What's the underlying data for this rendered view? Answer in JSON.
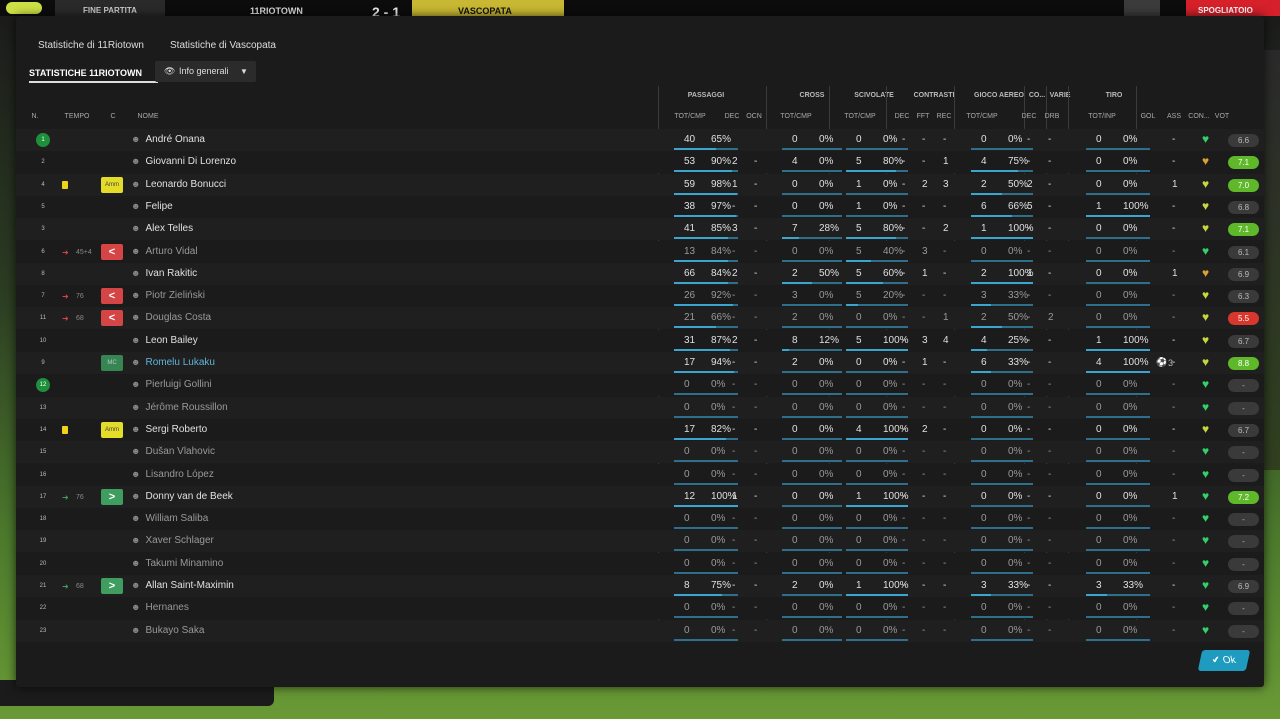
{
  "topbar": {
    "end_label": "FINE PARTITA",
    "home_team": "11RIOTOWN",
    "score": "2 - 1",
    "away_team": "VASCOPATA",
    "right_label": "SPOGLIATOIO"
  },
  "tabs": [
    {
      "label": "Statistiche di 11Riotown"
    },
    {
      "label": "Statistiche di Vascopata"
    }
  ],
  "section_title": "STATISTICHE 11RIOTOWN",
  "view_dropdown": {
    "label": "Info generali",
    "icon": "eye-icon"
  },
  "groups": {
    "passaggi": "PASSAGGI",
    "cross": "CROSS",
    "scivolate": "SCIVOLATE",
    "contrasti": "CONTRASTI",
    "gioco_aereo": "GIOCO AEREO",
    "co": "CO...",
    "varie": "VARIE",
    "tiro": "TIRO"
  },
  "columns": {
    "n": "N.",
    "tempo": "TEMPO",
    "c": "C",
    "nome": "NOME",
    "tot_cmp": "TOT/CMP",
    "dec": "DEC",
    "ocn": "OCN",
    "fft": "FFT",
    "rec": "REC",
    "drb": "DRB",
    "tot_inp": "TOT/INP",
    "gol": "GOL",
    "ass": "ASS",
    "con": "CON...",
    "vot": "VOT"
  },
  "players": [
    {
      "n": "1",
      "gk": true,
      "tempo": "",
      "sub": "",
      "tag": "",
      "name": "André Onana",
      "dim": false,
      "pass": [
        "40",
        "65%"
      ],
      "pdec": "",
      "pocn": "",
      "cross": [
        "0",
        "0%"
      ],
      "sciv": [
        "0",
        "0%"
      ],
      "cdec": "-",
      "cfft": "-",
      "crec": "-",
      "aereo": [
        "0",
        "0%"
      ],
      "codec": "-",
      "drb": "-",
      "tiro": [
        "0",
        "0%"
      ],
      "gol": "",
      "ass": "-",
      "heart": "green",
      "vot": "6.6",
      "vclass": "grey"
    },
    {
      "n": "2",
      "tempo": "",
      "sub": "",
      "tag": "",
      "name": "Giovanni Di Lorenzo",
      "dim": false,
      "pass": [
        "53",
        "90%"
      ],
      "pdec": "2",
      "pocn": "-",
      "cross": [
        "4",
        "0%"
      ],
      "sciv": [
        "5",
        "80%"
      ],
      "cdec": "-",
      "cfft": "-",
      "crec": "1",
      "aereo": [
        "4",
        "75%"
      ],
      "codec": "-",
      "drb": "-",
      "tiro": [
        "0",
        "0%"
      ],
      "gol": "",
      "ass": "-",
      "heart": "orange",
      "vot": "7.1",
      "vclass": "green"
    },
    {
      "n": "4",
      "tempo": "",
      "card": true,
      "sub": "",
      "tag": "Amm",
      "name": "Leonardo Bonucci",
      "dim": false,
      "pass": [
        "59",
        "98%"
      ],
      "pdec": "1",
      "pocn": "-",
      "cross": [
        "0",
        "0%"
      ],
      "sciv": [
        "1",
        "0%"
      ],
      "cdec": "-",
      "cfft": "2",
      "crec": "3",
      "aereo": [
        "2",
        "50%"
      ],
      "codec": "2",
      "drb": "-",
      "tiro": [
        "0",
        "0%"
      ],
      "gol": "",
      "ass": "1",
      "heart": "yellow",
      "vot": "7.0",
      "vclass": "green"
    },
    {
      "n": "5",
      "tempo": "",
      "sub": "",
      "tag": "",
      "name": "Felipe",
      "dim": false,
      "pass": [
        "38",
        "97%"
      ],
      "pdec": "-",
      "pocn": "-",
      "cross": [
        "0",
        "0%"
      ],
      "sciv": [
        "1",
        "0%"
      ],
      "cdec": "-",
      "cfft": "-",
      "crec": "-",
      "aereo": [
        "6",
        "66%"
      ],
      "codec": "5",
      "drb": "-",
      "tiro": [
        "1",
        "100%"
      ],
      "gol": "",
      "ass": "-",
      "heart": "yellow",
      "vot": "6.8",
      "vclass": "grey"
    },
    {
      "n": "3",
      "tempo": "",
      "sub": "",
      "tag": "",
      "name": "Alex Telles",
      "dim": false,
      "pass": [
        "41",
        "85%"
      ],
      "pdec": "3",
      "pocn": "-",
      "cross": [
        "7",
        "28%"
      ],
      "sciv": [
        "5",
        "80%"
      ],
      "cdec": "-",
      "cfft": "-",
      "crec": "2",
      "aereo": [
        "1",
        "100%"
      ],
      "codec": "-",
      "drb": "-",
      "tiro": [
        "0",
        "0%"
      ],
      "gol": "",
      "ass": "-",
      "heart": "yellow",
      "vot": "7.1",
      "vclass": "green"
    },
    {
      "n": "6",
      "tempo": "45+4",
      "subout": true,
      "tag": "<",
      "name": "Arturo Vidal",
      "dim": true,
      "pass": [
        "13",
        "84%"
      ],
      "pdec": "-",
      "pocn": "-",
      "cross": [
        "0",
        "0%"
      ],
      "sciv": [
        "5",
        "40%"
      ],
      "cdec": "-",
      "cfft": "3",
      "crec": "-",
      "aereo": [
        "0",
        "0%"
      ],
      "codec": "-",
      "drb": "-",
      "tiro": [
        "0",
        "0%"
      ],
      "gol": "",
      "ass": "-",
      "heart": "green",
      "vot": "6.1",
      "vclass": "grey"
    },
    {
      "n": "8",
      "tempo": "",
      "sub": "",
      "tag": "",
      "name": "Ivan Rakitic",
      "dim": false,
      "pass": [
        "66",
        "84%"
      ],
      "pdec": "2",
      "pocn": "-",
      "cross": [
        "2",
        "50%"
      ],
      "sciv": [
        "5",
        "60%"
      ],
      "cdec": "-",
      "cfft": "1",
      "crec": "-",
      "aereo": [
        "2",
        "100%"
      ],
      "codec": "1",
      "drb": "-",
      "tiro": [
        "0",
        "0%"
      ],
      "gol": "",
      "ass": "1",
      "heart": "orange",
      "vot": "6.9",
      "vclass": "grey"
    },
    {
      "n": "7",
      "tempo": "76",
      "subout": true,
      "tag": "<",
      "name": "Piotr Zieliński",
      "dim": true,
      "pass": [
        "26",
        "92%"
      ],
      "pdec": "-",
      "pocn": "-",
      "cross": [
        "3",
        "0%"
      ],
      "sciv": [
        "5",
        "20%"
      ],
      "cdec": "-",
      "cfft": "-",
      "crec": "-",
      "aereo": [
        "3",
        "33%"
      ],
      "codec": "-",
      "drb": "-",
      "tiro": [
        "0",
        "0%"
      ],
      "gol": "",
      "ass": "-",
      "heart": "yellow",
      "vot": "6.3",
      "vclass": "grey"
    },
    {
      "n": "11",
      "tempo": "68",
      "subout": true,
      "tag": "<",
      "name": "Douglas Costa",
      "dim": true,
      "pass": [
        "21",
        "66%"
      ],
      "pdec": "-",
      "pocn": "-",
      "cross": [
        "2",
        "0%"
      ],
      "sciv": [
        "0",
        "0%"
      ],
      "cdec": "-",
      "cfft": "-",
      "crec": "1",
      "aereo": [
        "2",
        "50%"
      ],
      "codec": "-",
      "drb": "2",
      "tiro": [
        "0",
        "0%"
      ],
      "gol": "",
      "ass": "-",
      "heart": "yellow",
      "vot": "5.5",
      "vclass": "red"
    },
    {
      "n": "10",
      "tempo": "",
      "sub": "",
      "tag": "",
      "name": "Leon Bailey",
      "dim": false,
      "pass": [
        "31",
        "87%"
      ],
      "pdec": "2",
      "pocn": "-",
      "cross": [
        "8",
        "12%"
      ],
      "sciv": [
        "5",
        "100%"
      ],
      "cdec": "-",
      "cfft": "3",
      "crec": "4",
      "aereo": [
        "4",
        "25%"
      ],
      "codec": "-",
      "drb": "-",
      "tiro": [
        "1",
        "100%"
      ],
      "gol": "",
      "ass": "-",
      "heart": "yellow",
      "vot": "6.7",
      "vclass": "grey"
    },
    {
      "n": "9",
      "tempo": "",
      "sub": "",
      "tag": "MC",
      "name": "Romelu Lukaku",
      "dim": false,
      "link": true,
      "pass": [
        "17",
        "94%"
      ],
      "pdec": "-",
      "pocn": "-",
      "cross": [
        "2",
        "0%"
      ],
      "sciv": [
        "0",
        "0%"
      ],
      "cdec": "-",
      "cfft": "1",
      "crec": "-",
      "aereo": [
        "6",
        "33%"
      ],
      "codec": "-",
      "drb": "-",
      "tiro": [
        "4",
        "100%"
      ],
      "gol": "3",
      "ass": "-",
      "heart": "yellow",
      "vot": "8.8",
      "vclass": "green"
    },
    {
      "n": "12",
      "gk": true,
      "tempo": "",
      "sub": "",
      "tag": "",
      "name": "Pierluigi Gollini",
      "dim": true,
      "pass": [
        "0",
        "0%"
      ],
      "pdec": "-",
      "pocn": "-",
      "cross": [
        "0",
        "0%"
      ],
      "sciv": [
        "0",
        "0%"
      ],
      "cdec": "-",
      "cfft": "-",
      "crec": "-",
      "aereo": [
        "0",
        "0%"
      ],
      "codec": "-",
      "drb": "-",
      "tiro": [
        "0",
        "0%"
      ],
      "gol": "",
      "ass": "-",
      "heart": "green",
      "vot": "-",
      "vclass": "grey"
    },
    {
      "n": "13",
      "tempo": "",
      "sub": "",
      "tag": "",
      "name": "Jérôme Roussillon",
      "dim": true,
      "pass": [
        "0",
        "0%"
      ],
      "pdec": "-",
      "pocn": "-",
      "cross": [
        "0",
        "0%"
      ],
      "sciv": [
        "0",
        "0%"
      ],
      "cdec": "-",
      "cfft": "-",
      "crec": "-",
      "aereo": [
        "0",
        "0%"
      ],
      "codec": "-",
      "drb": "-",
      "tiro": [
        "0",
        "0%"
      ],
      "gol": "",
      "ass": "-",
      "heart": "green",
      "vot": "-",
      "vclass": "grey"
    },
    {
      "n": "14",
      "tempo": "",
      "card": true,
      "sub": "",
      "tag": "Amm",
      "name": "Sergi Roberto",
      "dim": false,
      "pass": [
        "17",
        "82%"
      ],
      "pdec": "-",
      "pocn": "-",
      "cross": [
        "0",
        "0%"
      ],
      "sciv": [
        "4",
        "100%"
      ],
      "cdec": "-",
      "cfft": "2",
      "crec": "-",
      "aereo": [
        "0",
        "0%"
      ],
      "codec": "-",
      "drb": "-",
      "tiro": [
        "0",
        "0%"
      ],
      "gol": "",
      "ass": "-",
      "heart": "yellow",
      "vot": "6.7",
      "vclass": "grey"
    },
    {
      "n": "15",
      "tempo": "",
      "sub": "",
      "tag": "",
      "name": "Dušan Vlahovic",
      "dim": true,
      "pass": [
        "0",
        "0%"
      ],
      "pdec": "-",
      "pocn": "-",
      "cross": [
        "0",
        "0%"
      ],
      "sciv": [
        "0",
        "0%"
      ],
      "cdec": "-",
      "cfft": "-",
      "crec": "-",
      "aereo": [
        "0",
        "0%"
      ],
      "codec": "-",
      "drb": "-",
      "tiro": [
        "0",
        "0%"
      ],
      "gol": "",
      "ass": "-",
      "heart": "green",
      "vot": "-",
      "vclass": "grey"
    },
    {
      "n": "16",
      "tempo": "",
      "sub": "",
      "tag": "",
      "name": "Lisandro López",
      "dim": true,
      "pass": [
        "0",
        "0%"
      ],
      "pdec": "-",
      "pocn": "-",
      "cross": [
        "0",
        "0%"
      ],
      "sciv": [
        "0",
        "0%"
      ],
      "cdec": "-",
      "cfft": "-",
      "crec": "-",
      "aereo": [
        "0",
        "0%"
      ],
      "codec": "-",
      "drb": "-",
      "tiro": [
        "0",
        "0%"
      ],
      "gol": "",
      "ass": "-",
      "heart": "green",
      "vot": "-",
      "vclass": "grey"
    },
    {
      "n": "17",
      "tempo": "76",
      "subin": true,
      "tag": ">",
      "name": "Donny van de Beek",
      "dim": false,
      "pass": [
        "12",
        "100%"
      ],
      "pdec": "1",
      "pocn": "-",
      "cross": [
        "0",
        "0%"
      ],
      "sciv": [
        "1",
        "100%"
      ],
      "cdec": "-",
      "cfft": "-",
      "crec": "-",
      "aereo": [
        "0",
        "0%"
      ],
      "codec": "-",
      "drb": "-",
      "tiro": [
        "0",
        "0%"
      ],
      "gol": "",
      "ass": "1",
      "heart": "green",
      "vot": "7.2",
      "vclass": "green"
    },
    {
      "n": "18",
      "tempo": "",
      "sub": "",
      "tag": "",
      "name": "William Saliba",
      "dim": true,
      "pass": [
        "0",
        "0%"
      ],
      "pdec": "-",
      "pocn": "-",
      "cross": [
        "0",
        "0%"
      ],
      "sciv": [
        "0",
        "0%"
      ],
      "cdec": "-",
      "cfft": "-",
      "crec": "-",
      "aereo": [
        "0",
        "0%"
      ],
      "codec": "-",
      "drb": "-",
      "tiro": [
        "0",
        "0%"
      ],
      "gol": "",
      "ass": "-",
      "heart": "green",
      "vot": "-",
      "vclass": "grey"
    },
    {
      "n": "19",
      "tempo": "",
      "sub": "",
      "tag": "",
      "name": "Xaver Schlager",
      "dim": true,
      "pass": [
        "0",
        "0%"
      ],
      "pdec": "-",
      "pocn": "-",
      "cross": [
        "0",
        "0%"
      ],
      "sciv": [
        "0",
        "0%"
      ],
      "cdec": "-",
      "cfft": "-",
      "crec": "-",
      "aereo": [
        "0",
        "0%"
      ],
      "codec": "-",
      "drb": "-",
      "tiro": [
        "0",
        "0%"
      ],
      "gol": "",
      "ass": "-",
      "heart": "green",
      "vot": "-",
      "vclass": "grey"
    },
    {
      "n": "20",
      "tempo": "",
      "sub": "",
      "tag": "",
      "name": "Takumi Minamino",
      "dim": true,
      "pass": [
        "0",
        "0%"
      ],
      "pdec": "-",
      "pocn": "-",
      "cross": [
        "0",
        "0%"
      ],
      "sciv": [
        "0",
        "0%"
      ],
      "cdec": "-",
      "cfft": "-",
      "crec": "-",
      "aereo": [
        "0",
        "0%"
      ],
      "codec": "-",
      "drb": "-",
      "tiro": [
        "0",
        "0%"
      ],
      "gol": "",
      "ass": "-",
      "heart": "green",
      "vot": "-",
      "vclass": "grey"
    },
    {
      "n": "21",
      "tempo": "68",
      "subin": true,
      "tag": ">",
      "name": "Allan Saint-Maximin",
      "dim": false,
      "pass": [
        "8",
        "75%"
      ],
      "pdec": "-",
      "pocn": "-",
      "cross": [
        "2",
        "0%"
      ],
      "sciv": [
        "1",
        "100%"
      ],
      "cdec": "-",
      "cfft": "-",
      "crec": "-",
      "aereo": [
        "3",
        "33%"
      ],
      "codec": "-",
      "drb": "-",
      "tiro": [
        "3",
        "33%"
      ],
      "gol": "",
      "ass": "-",
      "heart": "green",
      "vot": "6.9",
      "vclass": "grey"
    },
    {
      "n": "22",
      "tempo": "",
      "sub": "",
      "tag": "",
      "name": "Hernanes",
      "dim": true,
      "pass": [
        "0",
        "0%"
      ],
      "pdec": "-",
      "pocn": "-",
      "cross": [
        "0",
        "0%"
      ],
      "sciv": [
        "0",
        "0%"
      ],
      "cdec": "-",
      "cfft": "-",
      "crec": "-",
      "aereo": [
        "0",
        "0%"
      ],
      "codec": "-",
      "drb": "-",
      "tiro": [
        "0",
        "0%"
      ],
      "gol": "",
      "ass": "-",
      "heart": "green",
      "vot": "-",
      "vclass": "grey"
    },
    {
      "n": "23",
      "tempo": "",
      "sub": "",
      "tag": "",
      "name": "Bukayo Saka",
      "dim": true,
      "pass": [
        "0",
        "0%"
      ],
      "pdec": "-",
      "pocn": "-",
      "cross": [
        "0",
        "0%"
      ],
      "sciv": [
        "0",
        "0%"
      ],
      "cdec": "-",
      "cfft": "-",
      "crec": "-",
      "aereo": [
        "0",
        "0%"
      ],
      "codec": "-",
      "drb": "-",
      "tiro": [
        "0",
        "0%"
      ],
      "gol": "",
      "ass": "-",
      "heart": "green",
      "vot": "-",
      "vclass": "grey"
    }
  ],
  "ok_button": {
    "label": "Ok",
    "icon": "check-icon"
  },
  "colors": {
    "accent": "#1f9bc0",
    "vote_green": "#5fb82a",
    "vote_red": "#d8372d",
    "heart_green": "#2fd36a",
    "heart_yellow": "#c8d83a",
    "heart_orange": "#d9a233"
  }
}
